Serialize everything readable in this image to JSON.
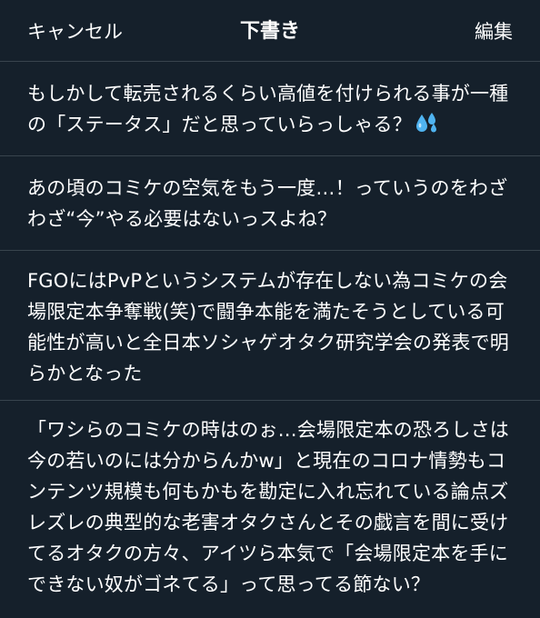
{
  "header": {
    "cancel_label": "キャンセル",
    "title": "下書き",
    "edit_label": "編集"
  },
  "drafts": [
    {
      "text": "もしかして転売されるくらい高値を付けられる事が一種の「ステータス」だと思っていらっしゃる？",
      "emoji": "sweat-droplets-icon"
    },
    {
      "text": "あの頃のコミケの空気をもう一度…！っていうのをわざわざ“今”やる必要はないっスよね？"
    },
    {
      "text": "FGOにはPvPというシステムが存在しない為コミケの会場限定本争奪戦(笑)で闘争本能を満たそうとしている可能性が高いと全日本ソシャゲオタク研究学会の発表で明らかとなった"
    },
    {
      "text": "「ワシらのコミケの時はのぉ…会場限定本の恐ろしさは今の若いのには分からんかw」と現在のコロナ情勢もコンテンツ規模も何もかもを勘定に入れ忘れている論点ズレズレの典型的な老害オタクさんとその戯言を間に受けてるオタクの方々、アイツら本気で「会場限定本を手にできない奴がゴネてる」って思ってる節ない？"
    }
  ],
  "colors": {
    "background": "#15202b",
    "divider": "#38444d",
    "text": "#ffffff",
    "emoji": "#4fb3f0"
  }
}
